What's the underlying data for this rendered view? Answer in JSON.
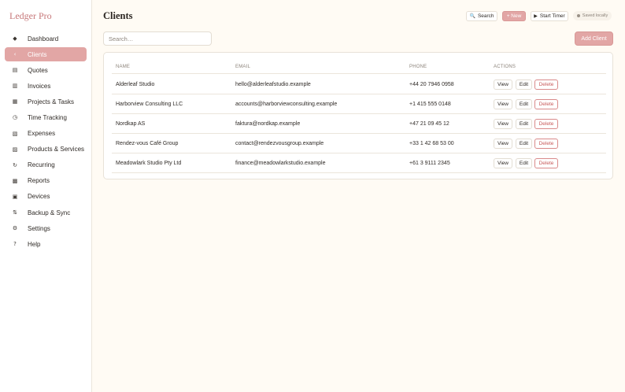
{
  "app": {
    "brand": "Ledger Pro"
  },
  "sidebar": {
    "items": [
      {
        "label": "Dashboard",
        "icon": "◆",
        "icon_name": "diamond-icon",
        "active": false
      },
      {
        "label": "Clients",
        "icon": "‹",
        "icon_name": "chevron-left-icon",
        "active": true
      },
      {
        "label": "Quotes",
        "icon": "▤",
        "icon_name": "document-icon",
        "active": false
      },
      {
        "label": "Invoices",
        "icon": "▥",
        "icon_name": "invoice-icon",
        "active": false
      },
      {
        "label": "Projects & Tasks",
        "icon": "▦",
        "icon_name": "grid-icon",
        "active": false
      },
      {
        "label": "Time Tracking",
        "icon": "◷",
        "icon_name": "clock-icon",
        "active": false
      },
      {
        "label": "Expenses",
        "icon": "▧",
        "icon_name": "receipt-icon",
        "active": false
      },
      {
        "label": "Products & Services",
        "icon": "▨",
        "icon_name": "box-icon",
        "active": false
      },
      {
        "label": "Recurring",
        "icon": "↻",
        "icon_name": "refresh-icon",
        "active": false
      },
      {
        "label": "Reports",
        "icon": "▩",
        "icon_name": "chart-icon",
        "active": false
      },
      {
        "label": "Devices",
        "icon": "▣",
        "icon_name": "device-icon",
        "active": false
      },
      {
        "label": "Backup & Sync",
        "icon": "⇅",
        "icon_name": "sync-icon",
        "active": false
      },
      {
        "label": "Settings",
        "icon": "⚙",
        "icon_name": "gear-icon",
        "active": false
      },
      {
        "label": "Help",
        "icon": "?",
        "icon_name": "help-icon",
        "active": false
      }
    ]
  },
  "header": {
    "title": "Clients",
    "search_label": "Search",
    "search_icon": "🔍",
    "new_label": "+ New",
    "timer_label": "Start Timer",
    "timer_icon": "▶",
    "saved_label": "Saved locally"
  },
  "toolbar": {
    "search_placeholder": "Search…",
    "add_label": "Add Client"
  },
  "table": {
    "columns": [
      "NAME",
      "EMAIL",
      "PHONE",
      "ACTIONS"
    ],
    "actions": {
      "view": "View",
      "edit": "Edit",
      "delete": "Delete"
    },
    "rows": [
      {
        "name": "Alderleaf Studio",
        "email": "hello@alderleafstudio.example",
        "phone": "+44 20 7946 0958"
      },
      {
        "name": "Harborview Consulting LLC",
        "email": "accounts@harborviewconsulting.example",
        "phone": "+1 415 555 0148"
      },
      {
        "name": "Nordkap AS",
        "email": "faktura@nordkap.example",
        "phone": "+47 21 09 45 12"
      },
      {
        "name": "Rendez-vous Café Group",
        "email": "contact@rendezvousgroup.example",
        "phone": "+33 1 42 68 53 00"
      },
      {
        "name": "Meadowlark Studio Pty Ltd",
        "email": "finance@meadowlarkstudio.example",
        "phone": "+61 3 9111 2345"
      }
    ]
  },
  "colors": {
    "accent": "#e2a6a5",
    "danger": "#c85b5b",
    "background": "#fffbf4"
  }
}
